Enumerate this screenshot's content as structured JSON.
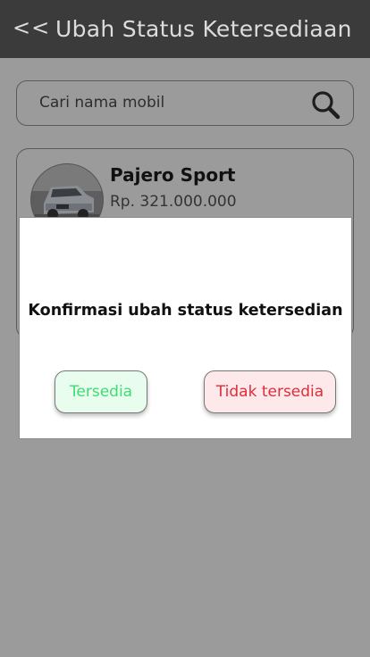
{
  "app_bar": {
    "back_label": "<<",
    "title": "Ubah Status Ketersediaan"
  },
  "search": {
    "placeholder": "Cari nama mobil",
    "value": "",
    "icon": "search-icon"
  },
  "car_list": [
    {
      "name": "Pajero Sport",
      "price": "Rp. 321.000.000"
    }
  ],
  "dialog": {
    "message": "Konfirmasi ubah status ketersedian",
    "available_label": "Tersedia",
    "unavailable_label": "Tidak tersedia"
  },
  "colors": {
    "app_bar": "#3b3b3b",
    "overlay": "#9b9b9b",
    "available_text": "#3fdc74",
    "available_bg": "#e8fdee",
    "unavailable_text": "#e02c3a",
    "unavailable_bg": "#fde8ea"
  }
}
